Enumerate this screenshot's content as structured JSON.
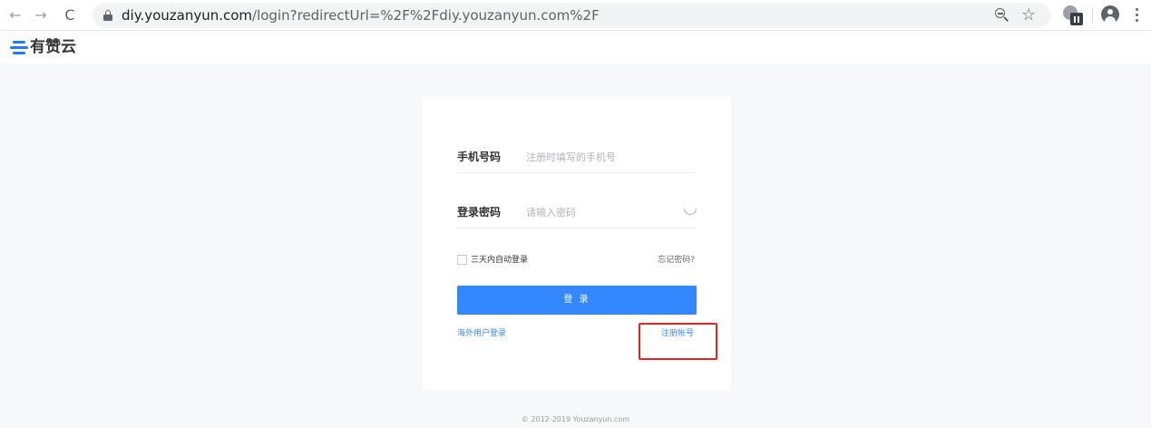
{
  "browser": {
    "url_host": "diy.youzanyun.com",
    "url_path": "/login?redirectUrl=%2F%2Fdiy.youzanyun.com%2F",
    "icons": {
      "back": "arrow-left-icon",
      "forward": "arrow-right-icon",
      "reload": "reload-icon",
      "secure": "lock-icon",
      "zoom": "zoom-out-icon",
      "bookmark": "star-icon",
      "extension": "extension-icon",
      "profile": "profile-icon",
      "menu": "more-vertical-icon"
    },
    "glyphs": {
      "back": "←",
      "forward": "→",
      "reload": "C",
      "star": "☆"
    }
  },
  "site": {
    "logo_text": "有赞云",
    "brand_color": "#1f7bff"
  },
  "login": {
    "phone_label": "手机号码",
    "phone_placeholder": "注册时填写的手机号",
    "password_label": "登录密码",
    "password_placeholder": "请输入密码",
    "remember_label": "三天内自动登录",
    "forgot_link": "忘记密码?",
    "submit_label": "登 录",
    "overseas_link": "海外用户登录",
    "register_link": "注册帐号",
    "accent_color": "#3388ff",
    "highlight_color": "#e82121"
  },
  "footer": {
    "copyright": "© 2012-2019 Youzanyun.com"
  }
}
